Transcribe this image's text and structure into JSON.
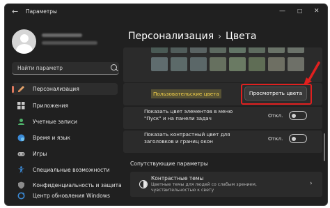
{
  "window": {
    "title": "Параметры"
  },
  "sidebar": {
    "search_placeholder": "Найти параметр",
    "items": [
      {
        "label": "Персонализация",
        "icon": "brush-icon",
        "active": true
      },
      {
        "label": "Приложения",
        "icon": "apps-icon"
      },
      {
        "label": "Учетные записи",
        "icon": "account-icon"
      },
      {
        "label": "Время и язык",
        "icon": "globe-clock-icon"
      },
      {
        "label": "Игры",
        "icon": "gamepad-icon"
      },
      {
        "label": "Специальные возможности",
        "icon": "accessibility-icon"
      },
      {
        "label": "Конфиденциальность и защита",
        "icon": "shield-icon"
      },
      {
        "label": "Центр обновления Windows",
        "icon": "update-icon"
      }
    ]
  },
  "header": {
    "section": "Персонализация",
    "separator": "›",
    "page": "Цвета"
  },
  "colors": {
    "swatches": [
      "#4a5a55",
      "#515d5b",
      "#5a6363",
      "#5d6a60",
      "#627566",
      "#5e6c5f",
      "#6a7368",
      "#6b726a",
      "#5f6c6e",
      "#5c6a69",
      "#5b6768",
      "#66705f",
      "#6a7a63",
      "#5f6d55",
      "#6e6f63",
      "#6e7068"
    ],
    "custom_label": "Пользовательские цвета",
    "view_button": "Просмотреть цвета",
    "annotation_color": "#e0201f"
  },
  "settings": [
    {
      "text": "Показать цвет элементов в меню \"Пуск\" и на панели задач",
      "state": "Откл."
    },
    {
      "text": "Показать контрастный цвет для заголовков и границ окон",
      "state": "Откл."
    }
  ],
  "related": {
    "title": "Сопутствующие параметры",
    "contrast_title": "Контрастные темы",
    "contrast_desc": "Цветные темы для людей со слабым зрением, чувствительностью к свету"
  }
}
